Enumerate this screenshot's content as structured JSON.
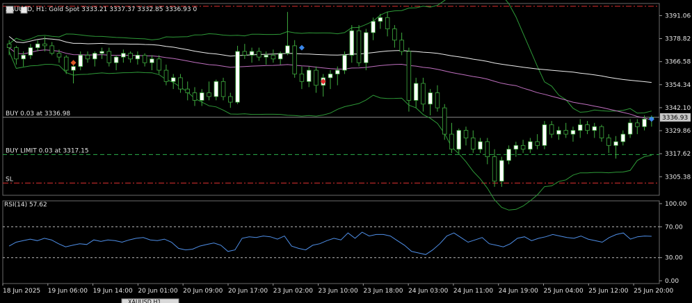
{
  "header": {
    "symbol_line": "XAUUSD, H1:  Gold Spot  3333.21 3337.37 3332.85 3336.93  0",
    "rsi_line": "RSI(14) 57.62"
  },
  "orders": [
    {
      "label": "BUY 0.03 at 3336.98",
      "price": 3336.98,
      "style": "solid",
      "color": "#8a8a8a"
    },
    {
      "label": "BUY LIMIT 0.03 at 3317.15",
      "price": 3317.15,
      "style": "dashed",
      "color": "#2bb24c"
    },
    {
      "label": "SL",
      "price": 3302.0,
      "style": "dashdot",
      "color": "#e03030"
    }
  ],
  "top_stop_line": {
    "price": 3396.0,
    "color": "#e03030"
  },
  "current_price_label": "3336.93",
  "tabs": [
    "XAUUSD,H1"
  ],
  "chart_data": [
    {
      "type": "candlestick",
      "title": "XAUUSD, H1: Gold Spot",
      "y_ticks": [
        "3391.06",
        "3378.82",
        "3366.58",
        "3354.34",
        "3342.10",
        "3329.86",
        "3317.62",
        "3305.38"
      ],
      "ylim": [
        3295.5,
        3397.5
      ],
      "x_labels": [
        "18 Jun 2025",
        "19 Jun 06:00",
        "19 Jun 14:00",
        "20 Jun 01:00",
        "20 Jun 09:00",
        "20 Jun 17:00",
        "23 Jun 02:00",
        "23 Jun 10:00",
        "23 Jun 18:00",
        "24 Jun 03:00",
        "24 Jun 11:00",
        "24 Jun 19:00",
        "25 Jun 04:00",
        "25 Jun 12:00",
        "25 Jun 20:00"
      ],
      "colors": {
        "up": "#ffffff",
        "down": "#d0d0d0",
        "outline": "#3fae3f",
        "bands": "#2e9b38",
        "ma_slow": "#ededed",
        "ma_mid": "#c070c0"
      },
      "candles": [
        [
          3376,
          3378,
          3370,
          3374
        ],
        [
          3374,
          3375,
          3365,
          3368
        ],
        [
          3368,
          3372,
          3364,
          3370
        ],
        [
          3370,
          3376,
          3368,
          3374
        ],
        [
          3374,
          3378,
          3372,
          3376
        ],
        [
          3376,
          3380,
          3372,
          3375
        ],
        [
          3375,
          3377,
          3370,
          3371
        ],
        [
          3371,
          3373,
          3366,
          3369
        ],
        [
          3369,
          3370,
          3360,
          3362
        ],
        [
          3362,
          3366,
          3355,
          3364
        ],
        [
          3364,
          3372,
          3362,
          3370
        ],
        [
          3370,
          3372,
          3366,
          3368
        ],
        [
          3368,
          3372,
          3364,
          3371
        ],
        [
          3371,
          3374,
          3368,
          3372
        ],
        [
          3372,
          3374,
          3364,
          3366
        ],
        [
          3366,
          3370,
          3362,
          3369
        ],
        [
          3369,
          3373,
          3366,
          3371
        ],
        [
          3371,
          3372,
          3366,
          3368
        ],
        [
          3368,
          3372,
          3365,
          3370
        ],
        [
          3370,
          3371,
          3364,
          3366
        ],
        [
          3366,
          3370,
          3362,
          3368
        ],
        [
          3368,
          3370,
          3360,
          3362
        ],
        [
          3362,
          3365,
          3354,
          3356
        ],
        [
          3356,
          3360,
          3352,
          3358
        ],
        [
          3358,
          3360,
          3350,
          3352
        ],
        [
          3352,
          3356,
          3346,
          3350
        ],
        [
          3350,
          3353,
          3343,
          3346
        ],
        [
          3346,
          3352,
          3343,
          3350
        ],
        [
          3350,
          3356,
          3346,
          3348
        ],
        [
          3348,
          3357,
          3346,
          3356
        ],
        [
          3356,
          3358,
          3346,
          3348
        ],
        [
          3348,
          3350,
          3342,
          3345
        ],
        [
          3345,
          3375,
          3344,
          3372
        ],
        [
          3372,
          3376,
          3368,
          3370
        ],
        [
          3370,
          3374,
          3366,
          3372
        ],
        [
          3372,
          3374,
          3367,
          3369
        ],
        [
          3369,
          3372,
          3365,
          3370
        ],
        [
          3370,
          3373,
          3366,
          3368
        ],
        [
          3368,
          3372,
          3365,
          3371
        ],
        [
          3371,
          3393,
          3370,
          3375
        ],
        [
          3375,
          3378,
          3358,
          3360
        ],
        [
          3360,
          3364,
          3352,
          3356
        ],
        [
          3356,
          3364,
          3353,
          3362
        ],
        [
          3362,
          3364,
          3350,
          3354
        ],
        [
          3354,
          3360,
          3348,
          3358
        ],
        [
          3358,
          3362,
          3352,
          3360
        ],
        [
          3360,
          3364,
          3354,
          3362
        ],
        [
          3362,
          3372,
          3360,
          3370
        ],
        [
          3370,
          3386,
          3366,
          3383
        ],
        [
          3383,
          3386,
          3364,
          3366
        ],
        [
          3366,
          3384,
          3362,
          3382
        ],
        [
          3382,
          3390,
          3378,
          3388
        ],
        [
          3388,
          3392,
          3384,
          3390
        ],
        [
          3390,
          3393,
          3380,
          3384
        ],
        [
          3384,
          3386,
          3374,
          3378
        ],
        [
          3378,
          3382,
          3370,
          3372
        ],
        [
          3372,
          3374,
          3340,
          3346
        ],
        [
          3346,
          3358,
          3342,
          3355
        ],
        [
          3355,
          3358,
          3340,
          3344
        ],
        [
          3344,
          3352,
          3338,
          3350
        ],
        [
          3350,
          3354,
          3340,
          3342
        ],
        [
          3342,
          3344,
          3325,
          3328
        ],
        [
          3328,
          3334,
          3318,
          3320
        ],
        [
          3320,
          3331,
          3318,
          3330
        ],
        [
          3330,
          3332,
          3322,
          3326
        ],
        [
          3326,
          3330,
          3318,
          3320
        ],
        [
          3320,
          3326,
          3318,
          3324
        ],
        [
          3324,
          3326,
          3312,
          3316
        ],
        [
          3316,
          3320,
          3300,
          3303
        ],
        [
          3303,
          3316,
          3300,
          3314
        ],
        [
          3314,
          3322,
          3312,
          3320
        ],
        [
          3320,
          3324,
          3316,
          3322
        ],
        [
          3322,
          3325,
          3318,
          3320
        ],
        [
          3320,
          3326,
          3318,
          3324
        ],
        [
          3324,
          3328,
          3320,
          3322
        ],
        [
          3322,
          3335,
          3320,
          3333
        ],
        [
          3333,
          3335,
          3326,
          3328
        ],
        [
          3328,
          3332,
          3325,
          3330
        ],
        [
          3330,
          3334,
          3326,
          3328
        ],
        [
          3328,
          3332,
          3324,
          3330
        ],
        [
          3330,
          3336,
          3326,
          3333
        ],
        [
          3333,
          3335,
          3328,
          3330
        ],
        [
          3330,
          3334,
          3326,
          3332
        ],
        [
          3332,
          3333,
          3324,
          3326
        ],
        [
          3326,
          3328,
          3318,
          3322
        ],
        [
          3322,
          3327,
          3315,
          3324
        ],
        [
          3324,
          3330,
          3322,
          3328
        ],
        [
          3328,
          3336,
          3326,
          3334
        ],
        [
          3334,
          3336,
          3328,
          3332
        ],
        [
          3332,
          3338,
          3330,
          3336
        ],
        [
          3336,
          3338,
          3332,
          3337
        ]
      ]
    },
    {
      "type": "line",
      "title": "RSI(14) 57.62",
      "y_ticks": [
        "100.00",
        "70.00",
        "30.00",
        "0.00"
      ],
      "ylim": [
        0,
        100
      ],
      "levels": [
        70,
        30
      ],
      "series": [
        {
          "color": "#4f8fe8",
          "values": [
            45,
            50,
            52,
            54,
            52,
            55,
            53,
            48,
            44,
            46,
            48,
            47,
            53,
            51,
            53,
            52,
            50,
            53,
            55,
            56,
            53,
            52,
            54,
            50,
            42,
            40,
            41,
            45,
            47,
            49,
            46,
            38,
            40,
            55,
            57,
            56,
            58,
            57,
            54,
            58,
            45,
            42,
            40,
            46,
            48,
            52,
            55,
            53,
            62,
            55,
            63,
            58,
            60,
            60,
            58,
            52,
            46,
            38,
            36,
            34,
            40,
            48,
            58,
            62,
            56,
            50,
            53,
            56,
            48,
            46,
            44,
            48,
            55,
            57,
            52,
            55,
            57,
            60,
            58,
            56,
            55,
            58,
            54,
            52,
            50,
            56,
            60,
            62,
            54,
            57,
            58,
            57.62
          ]
        }
      ]
    }
  ]
}
